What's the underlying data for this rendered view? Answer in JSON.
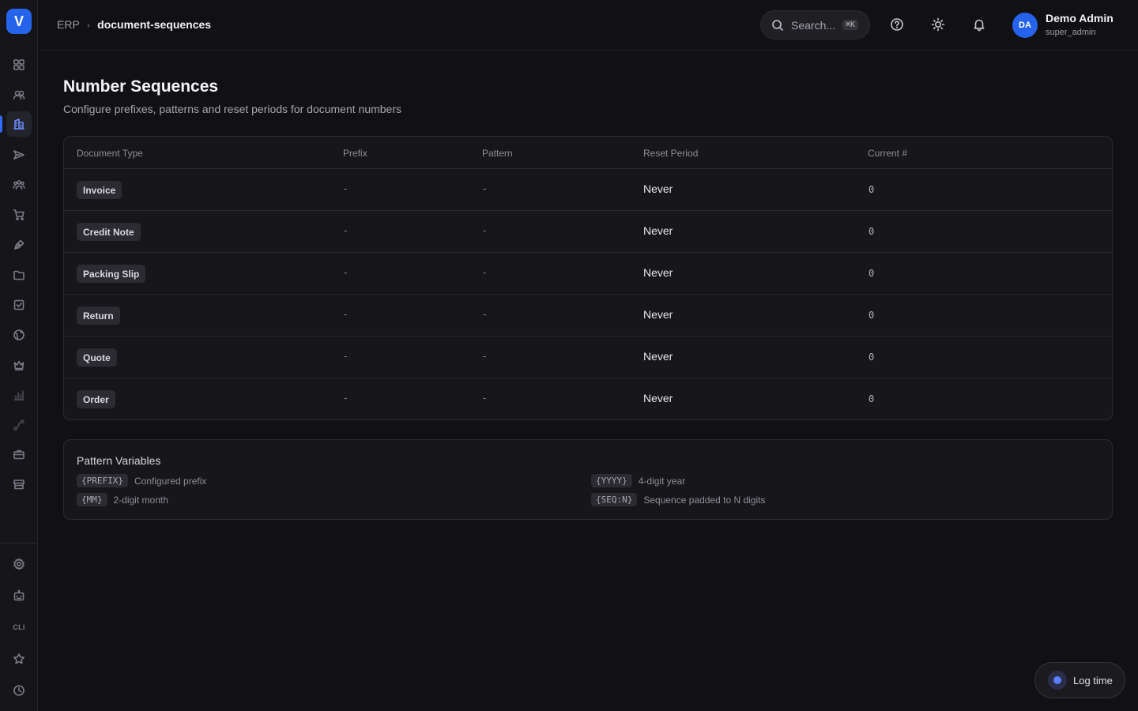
{
  "app": {
    "logo_letter": "V"
  },
  "breadcrumb": {
    "root": "ERP",
    "separator": "›",
    "current": "document-sequences"
  },
  "search": {
    "placeholder": "Search...",
    "shortcut": "⌘K"
  },
  "user": {
    "initials": "DA",
    "name": "Demo Admin",
    "role": "super_admin"
  },
  "sidebar": {
    "items": [
      {
        "icon": "dashboard-icon"
      },
      {
        "icon": "users-icon"
      },
      {
        "icon": "building-icon",
        "active": true
      },
      {
        "icon": "send-icon"
      },
      {
        "icon": "team-icon"
      },
      {
        "icon": "cart-icon"
      },
      {
        "icon": "pen-tool-icon"
      },
      {
        "icon": "folder-icon"
      },
      {
        "icon": "checkbox-icon"
      },
      {
        "icon": "globe-icon"
      },
      {
        "icon": "crown-icon"
      },
      {
        "icon": "bar-chart-icon"
      },
      {
        "icon": "workflow-icon"
      },
      {
        "icon": "briefcase-icon"
      },
      {
        "icon": "store-icon"
      }
    ],
    "bottom": [
      {
        "icon": "settings-icon"
      },
      {
        "icon": "robot-icon"
      },
      {
        "label": "CLI"
      },
      {
        "icon": "star-icon"
      },
      {
        "icon": "clock-icon"
      }
    ]
  },
  "page": {
    "title": "Number Sequences",
    "subtitle": "Configure prefixes, patterns and reset periods for document numbers"
  },
  "table": {
    "columns": [
      "Document Type",
      "Prefix",
      "Pattern",
      "Reset Period",
      "Current #"
    ],
    "rows": [
      {
        "type": "Invoice",
        "prefix": "-",
        "pattern": "-",
        "reset": "Never",
        "current": "0"
      },
      {
        "type": "Credit Note",
        "prefix": "-",
        "pattern": "-",
        "reset": "Never",
        "current": "0"
      },
      {
        "type": "Packing Slip",
        "prefix": "-",
        "pattern": "-",
        "reset": "Never",
        "current": "0"
      },
      {
        "type": "Return",
        "prefix": "-",
        "pattern": "-",
        "reset": "Never",
        "current": "0"
      },
      {
        "type": "Quote",
        "prefix": "-",
        "pattern": "-",
        "reset": "Never",
        "current": "0"
      },
      {
        "type": "Order",
        "prefix": "-",
        "pattern": "-",
        "reset": "Never",
        "current": "0"
      }
    ]
  },
  "pattern_variables": {
    "title": "Pattern Variables",
    "items": [
      {
        "code": "{PREFIX}",
        "desc": "Configured prefix"
      },
      {
        "code": "{YYYY}",
        "desc": "4-digit year"
      },
      {
        "code": "{MM}",
        "desc": "2-digit month"
      },
      {
        "code": "{SEQ:N}",
        "desc": "Sequence padded to N digits"
      }
    ]
  },
  "log_time": {
    "label": "Log time"
  },
  "colors": {
    "accent": "#2563eb",
    "background": "#111114",
    "card": "#17171b"
  }
}
